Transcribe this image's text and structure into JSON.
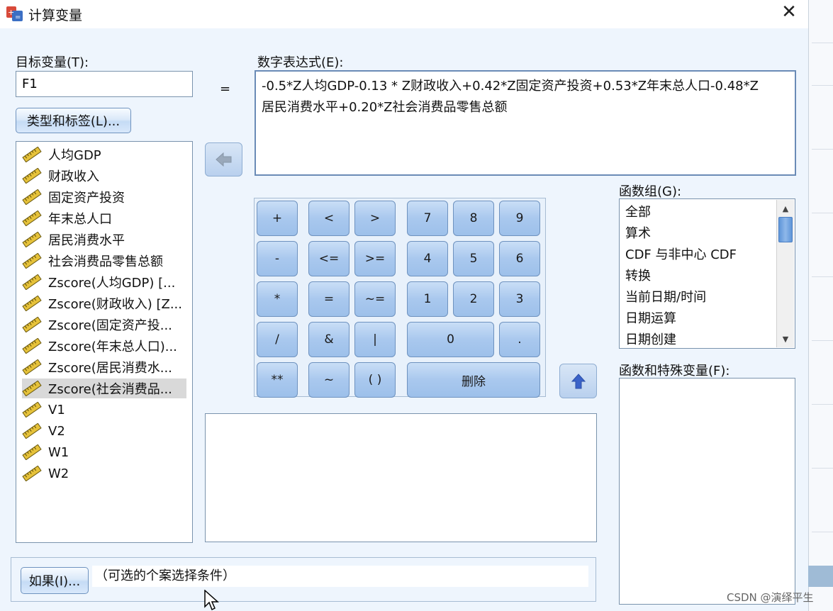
{
  "window": {
    "title": "计算变量",
    "close_label": "✕"
  },
  "target_var": {
    "label": "目标变量(T):",
    "value": "F1"
  },
  "equals_sign": "=",
  "type_label_button": "类型和标签(L)...",
  "variables": [
    {
      "name": "人均GDP"
    },
    {
      "name": "财政收入"
    },
    {
      "name": "固定资产投资"
    },
    {
      "name": "年末总人口"
    },
    {
      "name": "居民消费水平"
    },
    {
      "name": "社会消费品零售总额"
    },
    {
      "name": "Zscore(人均GDP) [..."
    },
    {
      "name": "Zscore(财政收入) [Z..."
    },
    {
      "name": "Zscore(固定资产投..."
    },
    {
      "name": "Zscore(年末总人口)..."
    },
    {
      "name": "Zscore(居民消费水..."
    },
    {
      "name": "Zscore(社会消费品...",
      "selected": true
    },
    {
      "name": "V1"
    },
    {
      "name": "V2"
    },
    {
      "name": "W1"
    },
    {
      "name": "W2"
    }
  ],
  "expression": {
    "label": "数字表达式(E):",
    "lines": [
      "-0.5*Z人均GDP-0.13 * Z财政收入+0.42*Z固定资产投资+0.53*Z年末总人口-0.48*Z",
      "居民消费水平+0.20*Z社会消费品零售总额"
    ]
  },
  "keypad": {
    "rows": [
      [
        "+",
        "<",
        ">",
        "7",
        "8",
        "9"
      ],
      [
        "-",
        "<=",
        ">=",
        "4",
        "5",
        "6"
      ],
      [
        "*",
        "=",
        "~=",
        "1",
        "2",
        "3"
      ],
      [
        "/",
        "&",
        "|",
        "0",
        "."
      ],
      [
        "**",
        "~",
        "( )",
        "删除"
      ]
    ]
  },
  "function_group": {
    "label": "函数组(G):",
    "items": [
      "全部",
      "算术",
      "CDF 与非中心 CDF",
      "转换",
      "当前日期/时间",
      "日期运算",
      "日期创建"
    ]
  },
  "special_vars": {
    "label": "函数和特殊变量(F):"
  },
  "if_section": {
    "button": "如果(I)...",
    "condition": "（可选的个案选择条件）"
  },
  "watermark": "CSDN @演绎平生",
  "colors": {
    "dialog_bg": "#eef5fd",
    "key_blue": "#a9c8ee",
    "selected_bg": "#d9d9d9",
    "scroll_thumb": "#5e95d8"
  },
  "icons": {
    "variable": "ruler-icon",
    "move_left": "arrow-left-icon",
    "move_up": "arrow-up-icon",
    "close": "close-icon"
  }
}
